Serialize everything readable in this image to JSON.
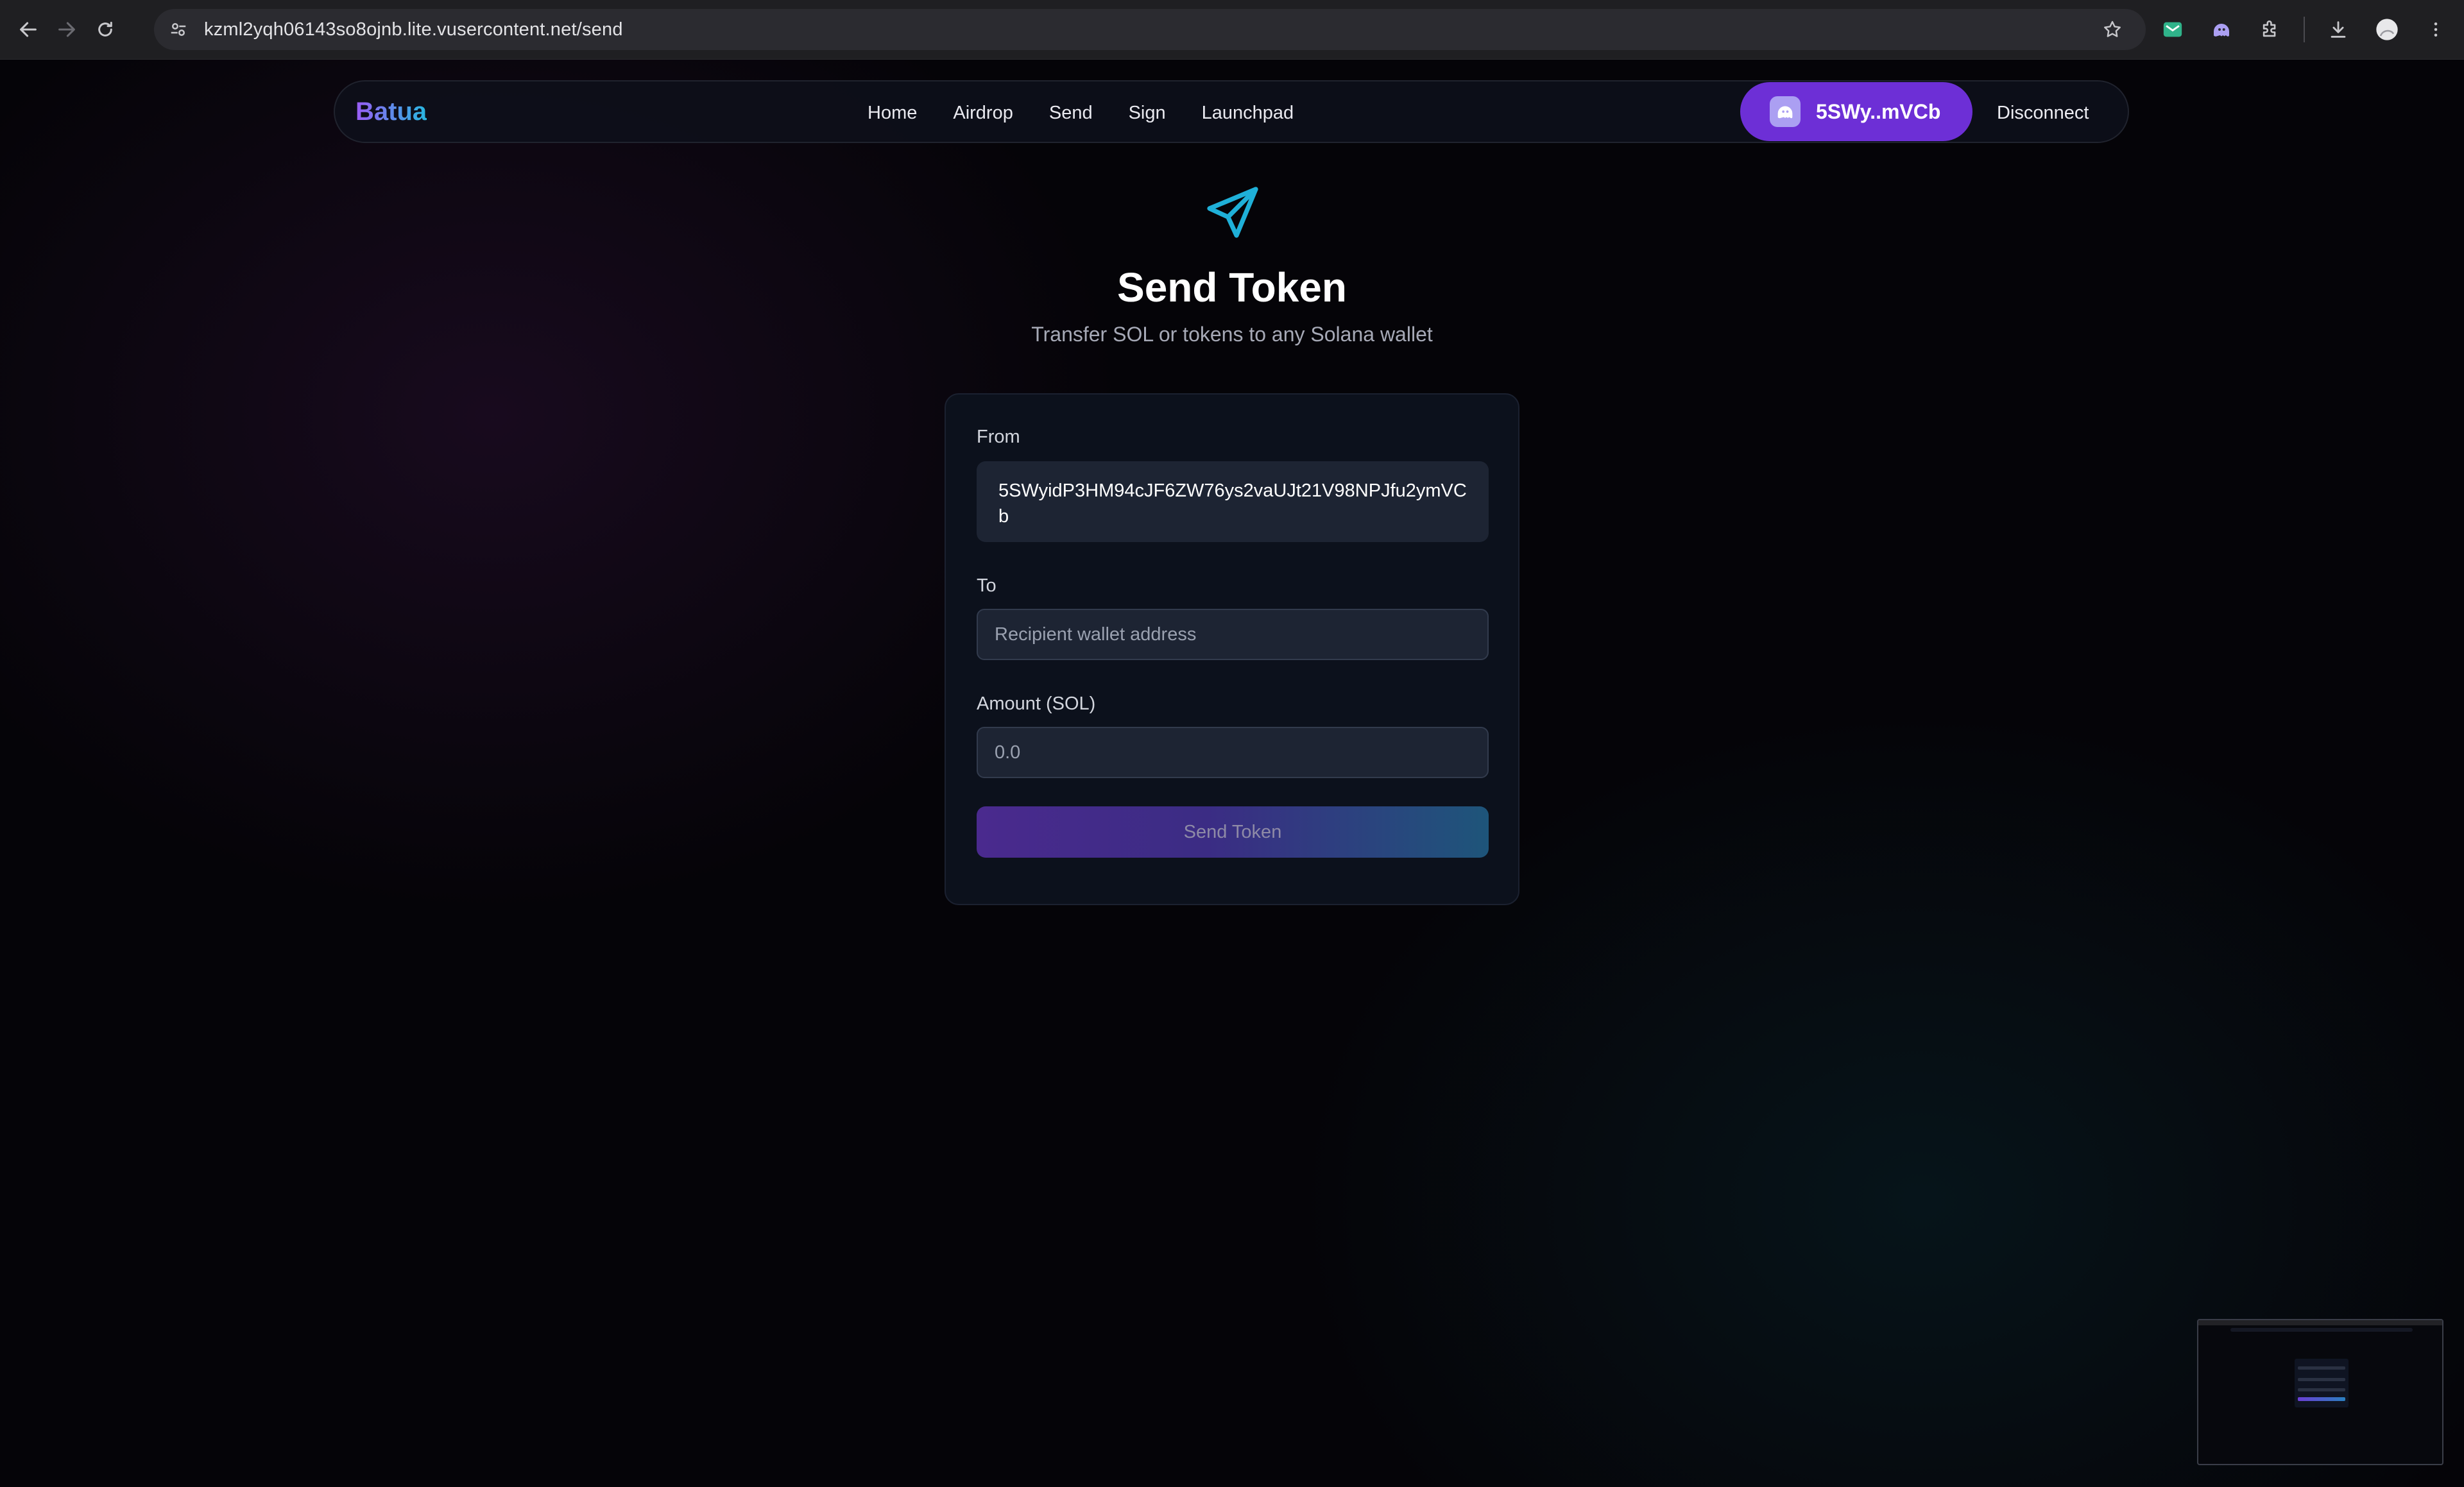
{
  "browser": {
    "url": "kzml2yqh06143so8ojnb.lite.vusercontent.net/send"
  },
  "nav": {
    "brand": "Batua",
    "links": [
      "Home",
      "Airdrop",
      "Send",
      "Sign",
      "Launchpad"
    ],
    "wallet_short": "5SWy..mVCb",
    "disconnect": "Disconnect"
  },
  "hero": {
    "icon": "send-paper-plane-icon",
    "title": "Send Token",
    "subtitle": "Transfer SOL or tokens to any Solana wallet"
  },
  "form": {
    "from_label": "From",
    "from_value": "5SWyidP3HM94cJF6ZW76ys2vaUJt21V98NPJfu2ymVCb",
    "to_label": "To",
    "to_placeholder": "Recipient wallet address",
    "amount_label": "Amount (SOL)",
    "amount_placeholder": "0.0",
    "submit_label": "Send Token"
  },
  "colors": {
    "accent_purple": "#6d2fd6",
    "accent_cyan": "#1fb0d8",
    "card_bg": "#0c111c"
  }
}
